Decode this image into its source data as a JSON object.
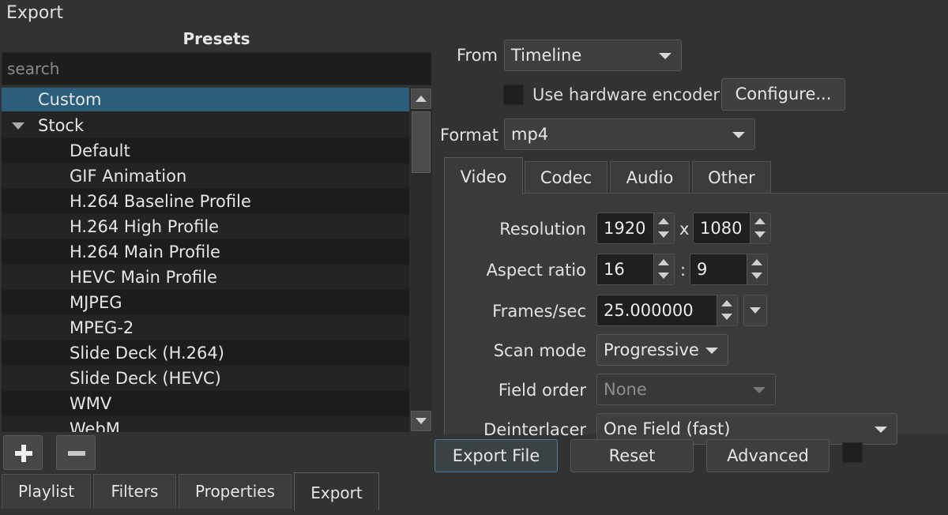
{
  "panel": {
    "title": "Export"
  },
  "presets": {
    "heading": "Presets",
    "search_placeholder": "search",
    "items": [
      {
        "label": "Custom",
        "level": 0,
        "selected": true
      },
      {
        "label": "Stock",
        "level": 0,
        "expandable": true
      },
      {
        "label": "Default",
        "level": 1
      },
      {
        "label": "GIF Animation",
        "level": 1
      },
      {
        "label": "H.264 Baseline Profile",
        "level": 1
      },
      {
        "label": "H.264 High Profile",
        "level": 1
      },
      {
        "label": "H.264 Main Profile",
        "level": 1
      },
      {
        "label": "HEVC Main Profile",
        "level": 1
      },
      {
        "label": "MJPEG",
        "level": 1
      },
      {
        "label": "MPEG-2",
        "level": 1
      },
      {
        "label": "Slide Deck (H.264)",
        "level": 1
      },
      {
        "label": "Slide Deck (HEVC)",
        "level": 1
      },
      {
        "label": "WMV",
        "level": 1
      },
      {
        "label": "WebM",
        "level": 1
      }
    ]
  },
  "bottom_tabs": [
    {
      "label": "Playlist"
    },
    {
      "label": "Filters"
    },
    {
      "label": "Properties"
    },
    {
      "label": "Export",
      "active": true
    }
  ],
  "form": {
    "from_label": "From",
    "from_value": "Timeline",
    "hw_encoder_label": "Use hardware encoder",
    "configure_label": "Configure...",
    "format_label": "Format",
    "format_value": "mp4"
  },
  "tabs": [
    {
      "label": "Video",
      "active": true
    },
    {
      "label": "Codec"
    },
    {
      "label": "Audio"
    },
    {
      "label": "Other"
    }
  ],
  "video": {
    "resolution_label": "Resolution",
    "width": "1920",
    "res_sep": "x",
    "height": "1080",
    "aspect_label": "Aspect ratio",
    "aspect_w": "16",
    "aspect_sep": ":",
    "aspect_h": "9",
    "fps_label": "Frames/sec",
    "fps": "25.000000",
    "scan_label": "Scan mode",
    "scan_value": "Progressive",
    "field_label": "Field order",
    "field_value": "None",
    "deint_label": "Deinterlacer",
    "deint_value": "One Field (fast)"
  },
  "actions": {
    "export_file": "Export File",
    "reset": "Reset",
    "advanced": "Advanced"
  },
  "colors": {
    "background": "#323232",
    "selection": "#2b5e7a",
    "input_bg": "#1f1f1f"
  }
}
